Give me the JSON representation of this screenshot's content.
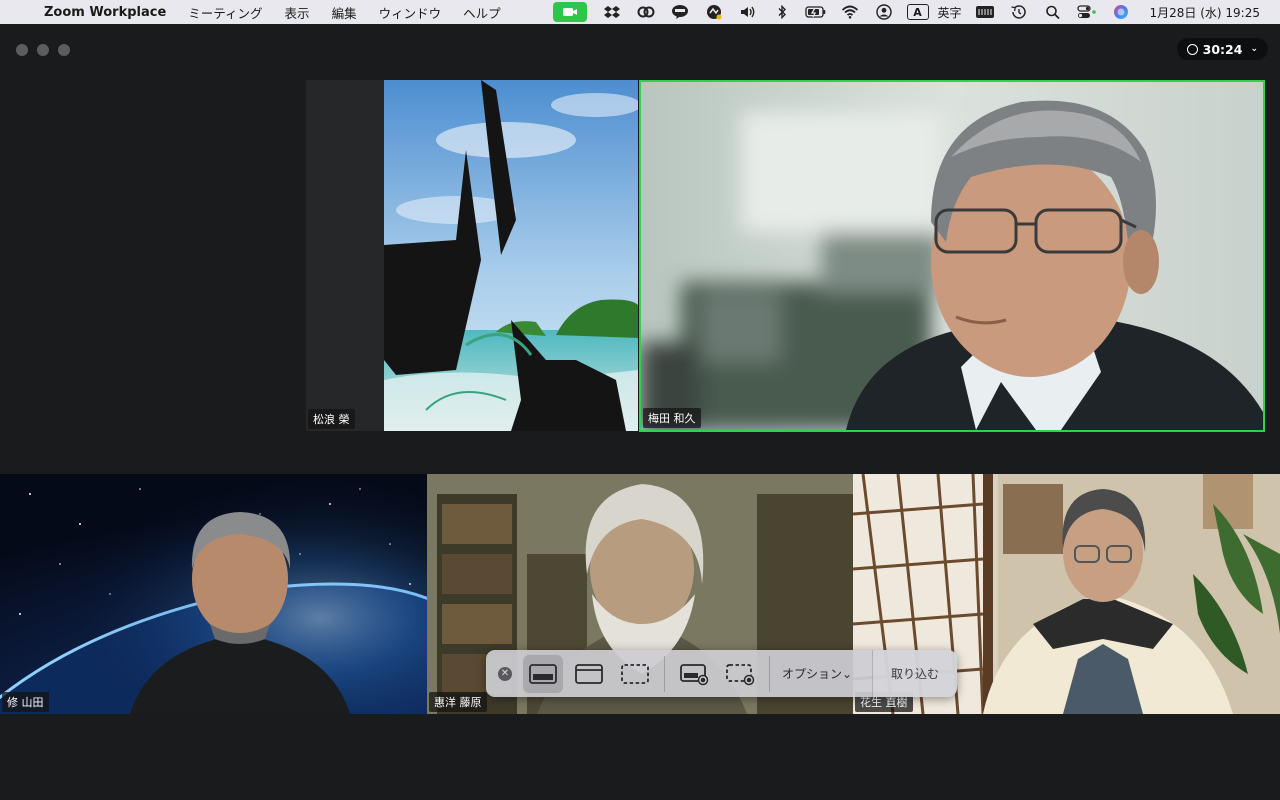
{
  "menubar": {
    "app_name": "Zoom Workplace",
    "menus": [
      "ミーティング",
      "表示",
      "編集",
      "ウィンドウ",
      "ヘルプ"
    ],
    "input_mode_badge": "A",
    "input_mode_label": "英字",
    "datetime": "1月28日 (水)  19:25"
  },
  "window": {
    "timer": "30:24"
  },
  "participants": [
    {
      "name": "松浪 榮"
    },
    {
      "name": "梅田 和久"
    },
    {
      "name": "修 山田"
    },
    {
      "name": "惠洋 藤原"
    },
    {
      "name": "花生 直樹"
    }
  ],
  "capture_toolbar": {
    "options_label": "オプション⌄",
    "capture_label": "取り込む"
  },
  "colors": {
    "active_speaker_border": "#2cd44c",
    "camera_indicator": "#2fc54a"
  }
}
